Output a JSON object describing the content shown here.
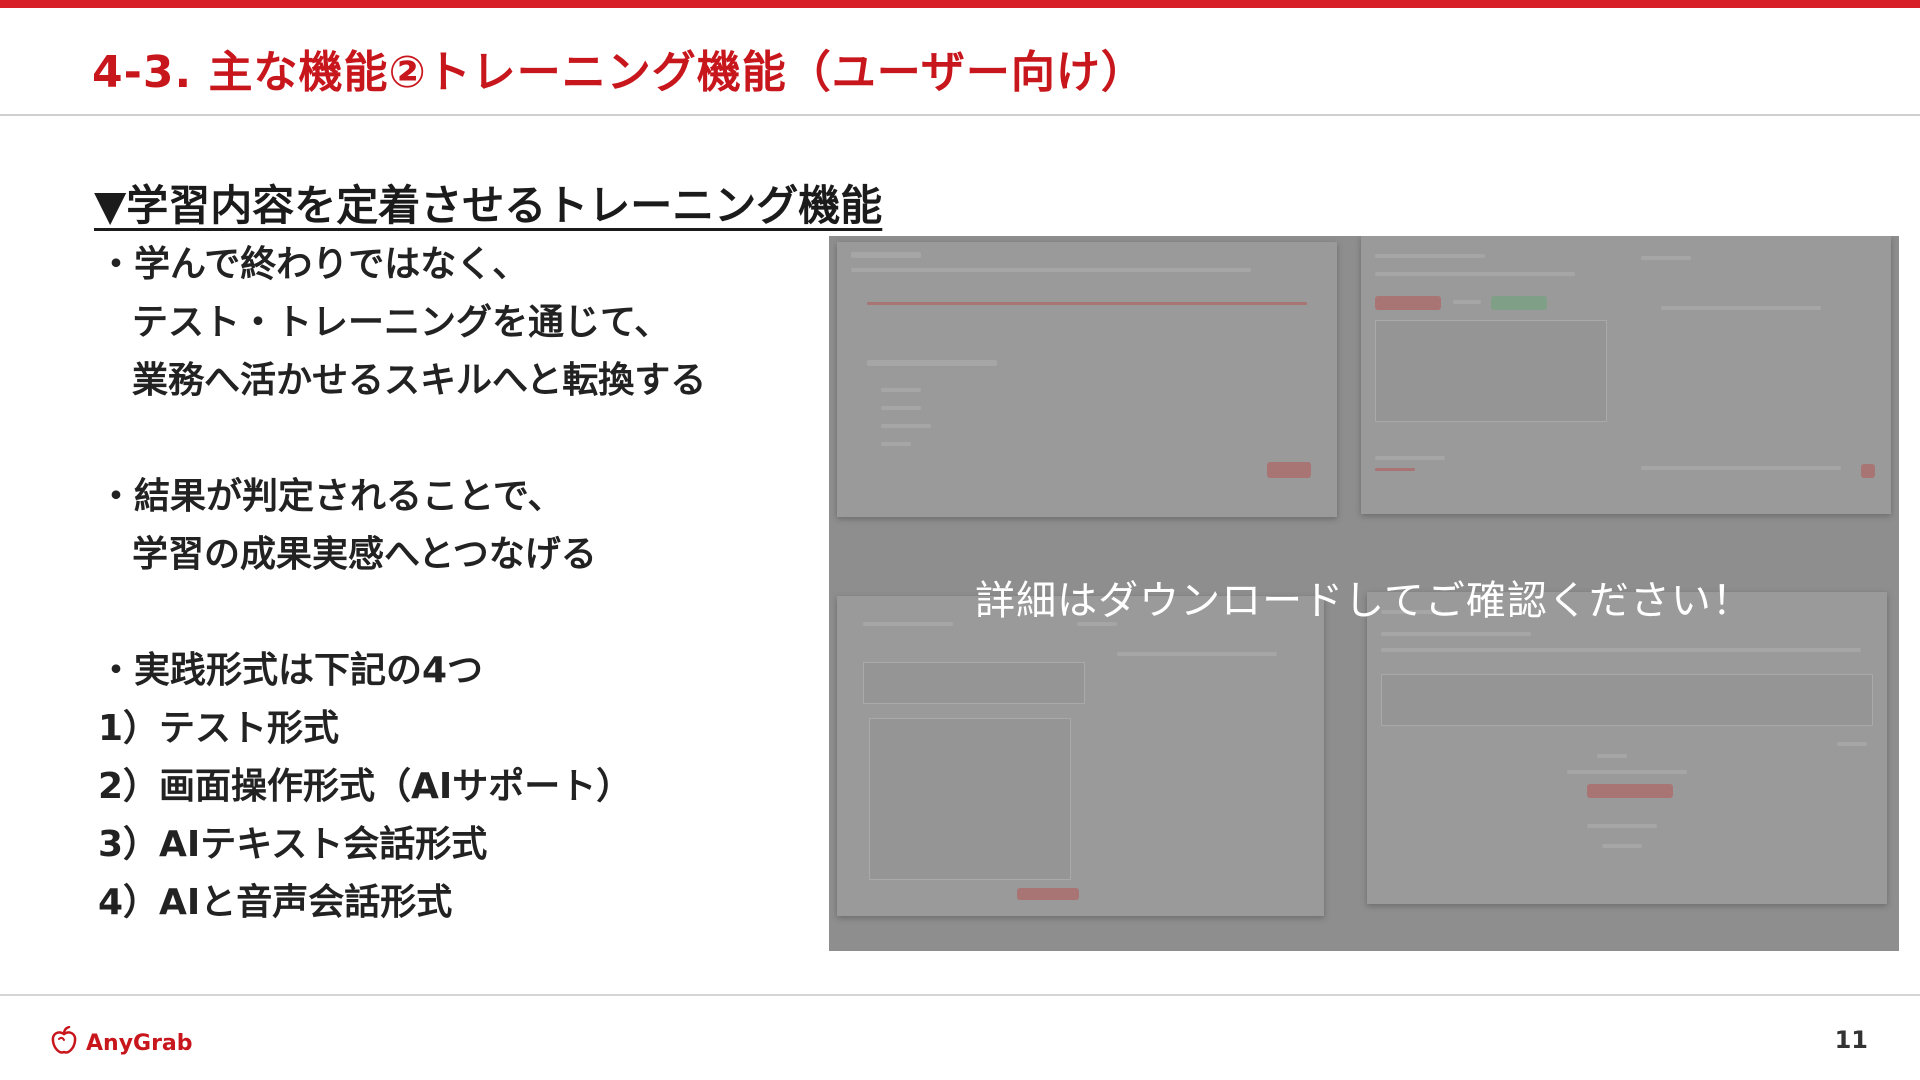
{
  "header": {
    "title": "4-3. 主な機能②トレーニング機能（ユーザー向け）"
  },
  "section": {
    "heading": "▼学習内容を定着させるトレーニング機能"
  },
  "bullets": {
    "b1_l1": "・学んで終わりではなく、",
    "b1_l2": "テスト・トレーニングを通じて、",
    "b1_l3": "業務へ活かせるスキルへと転換する",
    "b2_l1": "・結果が判定されることで、",
    "b2_l2": "学習の成果実感へとつなげる",
    "b3_l1": "・実践形式は下記の4つ"
  },
  "formats": [
    "1）テスト形式",
    "2）画面操作形式（AIサポート）",
    "3）AIテキスト会話形式",
    "4）AIと音声会話形式"
  ],
  "preview": {
    "overlay_text": "詳細はダウンロードしてご確認ください！"
  },
  "footer": {
    "logo_text": "AnyGrab",
    "page_number": "11"
  },
  "colors": {
    "accent": "#d61f26",
    "title": "#c8161d",
    "overlay": "#8e8e8e"
  }
}
